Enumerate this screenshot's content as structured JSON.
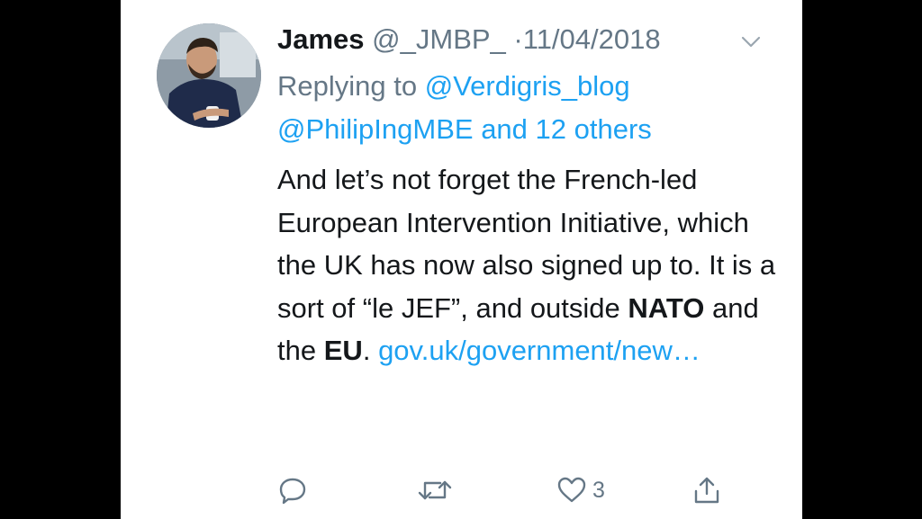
{
  "tweet": {
    "author_name": "James",
    "author_handle": "@_JMBP_",
    "separator": "·",
    "date": "11/04/2018",
    "replying_prefix": "Replying to",
    "reply_to_1": "@Verdigris_blog",
    "reply_to_2": "@PhilipIngMBE",
    "reply_others": "and 12 others",
    "body_1": "And let’s not forget the French-led European Intervention Initiative, which the UK has now also signed up to. It is a sort of “le JEF”, and outside",
    "body_bold_1": "NATO",
    "body_2": "and the",
    "body_bold_2": "EU",
    "body_3": ".",
    "body_link": "gov.uk/government/new…",
    "like_count": "3"
  },
  "icons": [
    "avatar",
    "chevron-down-icon",
    "reply-icon",
    "retweet-icon",
    "like-icon",
    "share-icon"
  ],
  "colors": {
    "link": "#1da1f2",
    "secondary_text": "#657786",
    "primary_text": "#14171a",
    "background": "#ffffff",
    "letterbox": "#000000"
  }
}
